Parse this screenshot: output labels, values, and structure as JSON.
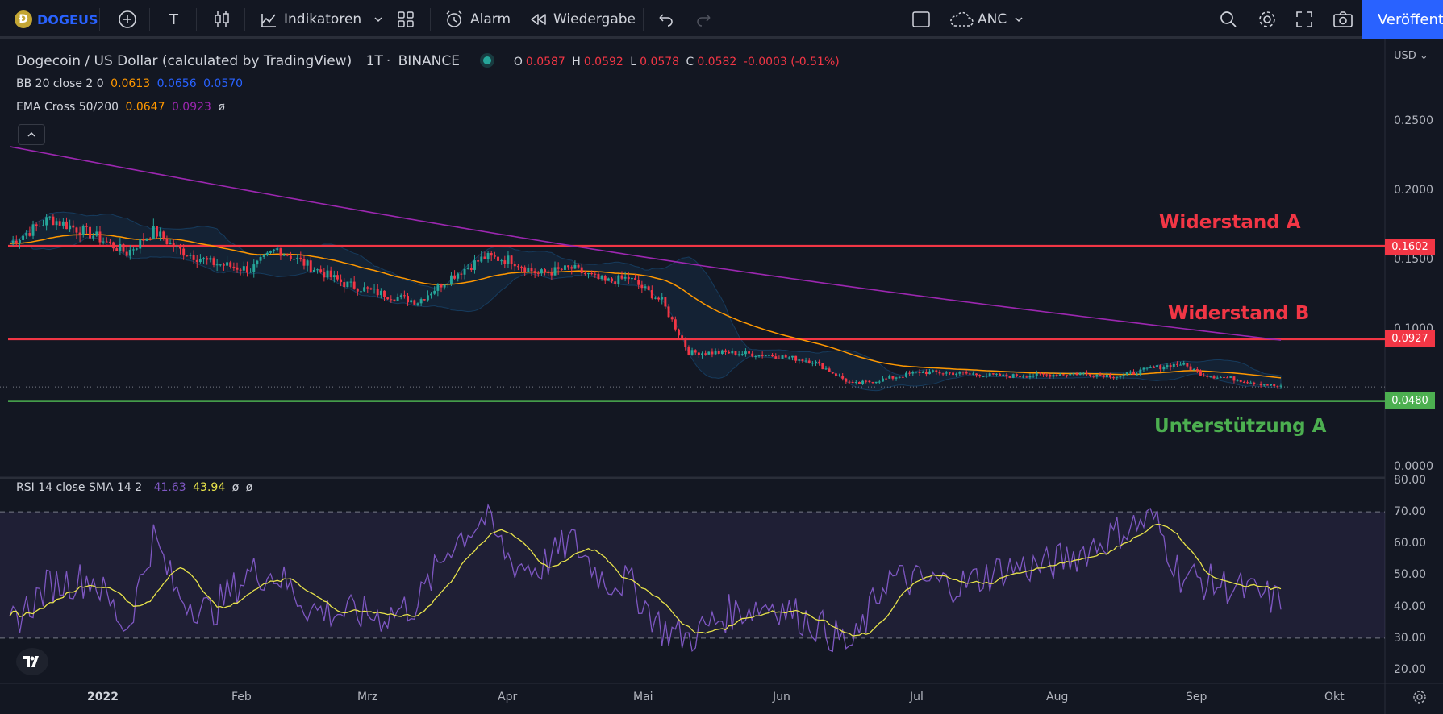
{
  "toolbar": {
    "symbol": "DOGEUSD",
    "indicators_label": "Indikatoren",
    "alert_label": "Alarm",
    "replay_label": "Wiedergabe",
    "text_tool_label": "T",
    "layout_name": "ANC",
    "publish_label": "Veröffent"
  },
  "legend": {
    "title": "Dogecoin / US Dollar (calculated by TradingView)",
    "interval": "1T",
    "exchange": "BINANCE",
    "open_label": "O",
    "open": "0.0587",
    "high_label": "H",
    "high": "0.0592",
    "low_label": "L",
    "low": "0.0578",
    "close_label": "C",
    "close": "0.0582",
    "change": "-0.0003 (-0.51%)",
    "bb_label": "BB 20 close 2 0",
    "bb_basis": "0.0613",
    "bb_upper": "0.0656",
    "bb_lower": "0.0570",
    "ema_label": "EMA Cross 50/200",
    "ema_fast": "0.0647",
    "ema_slow": "0.0923",
    "ema_null": "ø",
    "rsi_label": "RSI 14 close SMA 14 2",
    "rsi_value": "41.63",
    "rsi_sma": "43.94",
    "rsi_null1": "ø",
    "rsi_null2": "ø"
  },
  "price_axis": {
    "currency": "USD",
    "ticks": [
      "0.2500",
      "0.2000",
      "0.1500",
      "0.1000",
      "0.0000"
    ]
  },
  "rsi_axis": {
    "ticks": [
      "80.00",
      "70.00",
      "60.00",
      "50.00",
      "40.00",
      "30.00",
      "20.00"
    ]
  },
  "time_axis": {
    "ticks": [
      "2022",
      "Feb",
      "Mrz",
      "Apr",
      "Mai",
      "Jun",
      "Jul",
      "Aug",
      "Sep",
      "Okt"
    ]
  },
  "levels": [
    {
      "name": "Widerstand A",
      "price": "0.1602",
      "color": "#f23645"
    },
    {
      "name": "Widerstand B",
      "price": "0.0927",
      "color": "#f23645"
    },
    {
      "name": "Unterstützung A",
      "price": "0.0480",
      "color": "#4caf50"
    }
  ],
  "colors": {
    "up": "#26a69a",
    "down": "#f23645",
    "ema_fast": "#ff9800",
    "ema_slow": "#9c27b0",
    "rsi": "#7e57c2",
    "rsi_sma": "#e8e34a",
    "accent": "#2962ff",
    "coin": "#c3a634"
  },
  "chart_data": {
    "type": "candlestick",
    "price_ylim": [
      0,
      0.27
    ],
    "rsi_ylim": [
      15,
      82
    ],
    "close_trend": [
      [
        0,
        0.162
      ],
      [
        12,
        0.18
      ],
      [
        25,
        0.168
      ],
      [
        35,
        0.155
      ],
      [
        43,
        0.171
      ],
      [
        50,
        0.158
      ],
      [
        60,
        0.148
      ],
      [
        72,
        0.143
      ],
      [
        80,
        0.158
      ],
      [
        90,
        0.145
      ],
      [
        100,
        0.133
      ],
      [
        112,
        0.125
      ],
      [
        122,
        0.12
      ],
      [
        132,
        0.138
      ],
      [
        142,
        0.152
      ],
      [
        150,
        0.15
      ],
      [
        158,
        0.14
      ],
      [
        168,
        0.144
      ],
      [
        178,
        0.134
      ],
      [
        185,
        0.137
      ],
      [
        195,
        0.12
      ],
      [
        203,
        0.083
      ],
      [
        215,
        0.083
      ],
      [
        228,
        0.081
      ],
      [
        240,
        0.077
      ],
      [
        252,
        0.06
      ],
      [
        262,
        0.064
      ],
      [
        272,
        0.069
      ],
      [
        285,
        0.068
      ],
      [
        297,
        0.066
      ],
      [
        310,
        0.067
      ],
      [
        320,
        0.068
      ],
      [
        332,
        0.066
      ],
      [
        342,
        0.072
      ],
      [
        350,
        0.075
      ],
      [
        357,
        0.067
      ],
      [
        366,
        0.064
      ],
      [
        380,
        0.058
      ]
    ],
    "rsi_trend": [
      [
        0,
        34
      ],
      [
        12,
        47
      ],
      [
        25,
        49
      ],
      [
        35,
        33
      ],
      [
        43,
        62
      ],
      [
        50,
        44
      ],
      [
        60,
        38
      ],
      [
        72,
        51
      ],
      [
        80,
        50
      ],
      [
        90,
        39
      ],
      [
        100,
        38
      ],
      [
        112,
        37
      ],
      [
        122,
        41
      ],
      [
        132,
        60
      ],
      [
        142,
        68
      ],
      [
        150,
        54
      ],
      [
        158,
        52
      ],
      [
        168,
        61
      ],
      [
        178,
        48
      ],
      [
        185,
        48
      ],
      [
        195,
        33
      ],
      [
        203,
        30
      ],
      [
        215,
        38
      ],
      [
        228,
        41
      ],
      [
        240,
        35
      ],
      [
        252,
        27
      ],
      [
        262,
        49
      ],
      [
        272,
        48
      ],
      [
        285,
        47
      ],
      [
        297,
        52
      ],
      [
        310,
        53
      ],
      [
        320,
        57
      ],
      [
        332,
        64
      ],
      [
        342,
        68
      ],
      [
        350,
        50
      ],
      [
        357,
        48
      ],
      [
        366,
        46
      ],
      [
        380,
        41.6
      ]
    ]
  }
}
